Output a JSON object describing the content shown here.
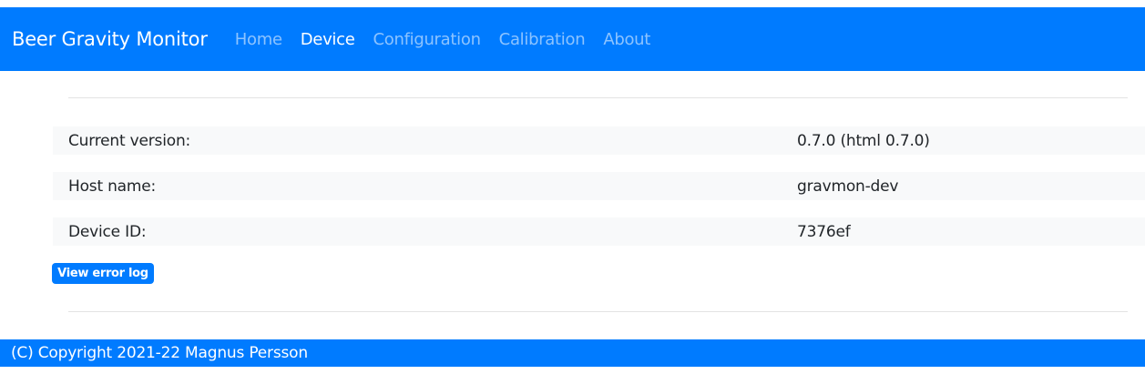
{
  "navbar": {
    "brand": "Beer Gravity Monitor",
    "items": [
      {
        "label": "Home"
      },
      {
        "label": "Device"
      },
      {
        "label": "Configuration"
      },
      {
        "label": "Calibration"
      },
      {
        "label": "About"
      }
    ],
    "active": "Device"
  },
  "device_info": [
    {
      "label": "Current version:",
      "value": "0.7.0 (html 0.7.0)"
    },
    {
      "label": "Host name:",
      "value": "gravmon-dev"
    },
    {
      "label": "Device ID:",
      "value": "7376ef"
    }
  ],
  "actions": {
    "view_error_log": "View error log"
  },
  "footer": {
    "copyright": "(C) Copyright 2021-22 Magnus Persson"
  },
  "colors": {
    "primary": "#007bff",
    "row_background": "#f8f9fa",
    "divider": "#e3e3e3"
  }
}
